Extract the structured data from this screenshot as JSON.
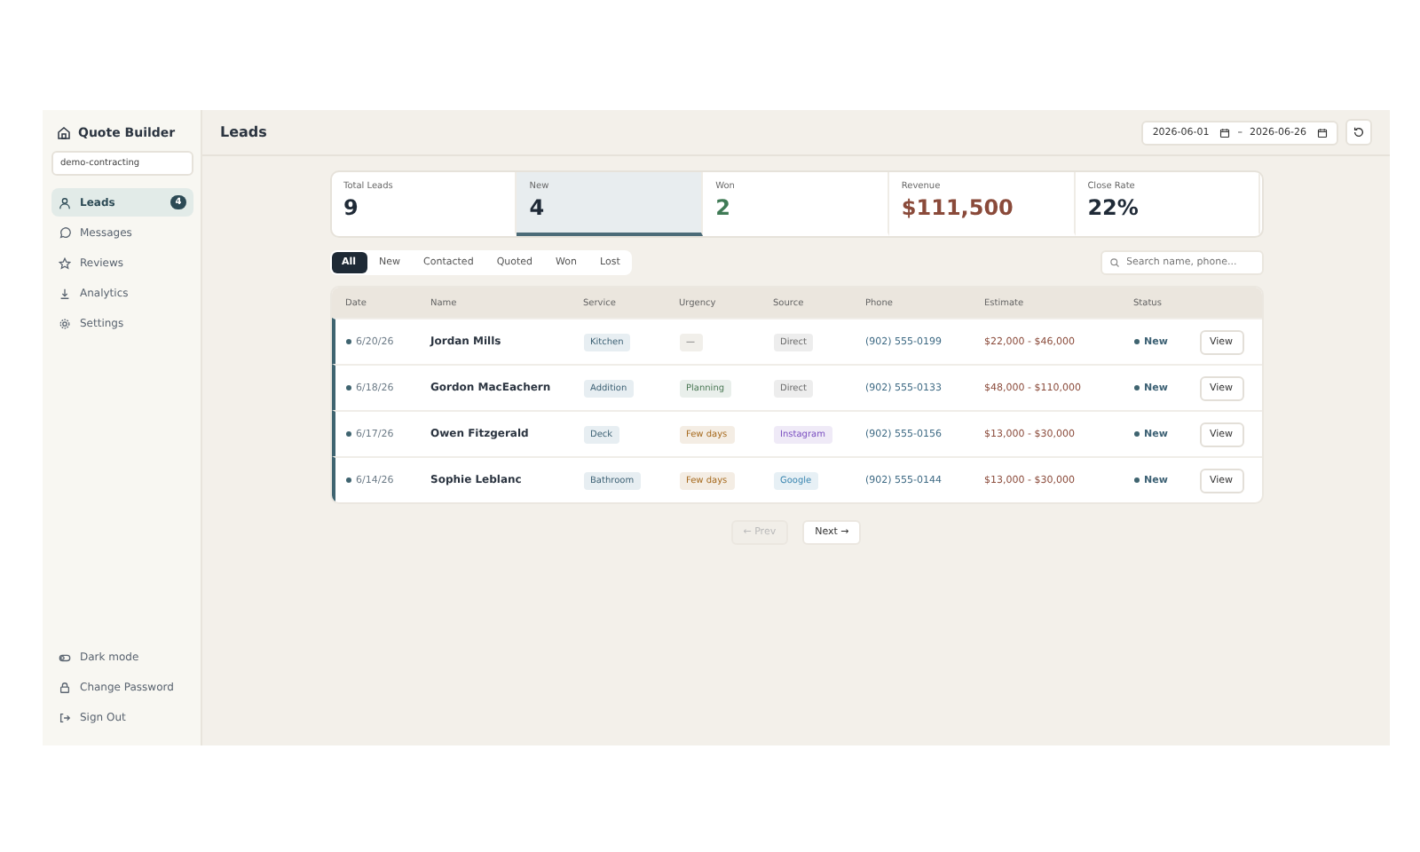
{
  "sidebar": {
    "brand": "Quote Builder",
    "workspace": "demo-contracting",
    "items": [
      {
        "label": "Leads",
        "selected": true,
        "badge": "4"
      },
      {
        "label": "Messages",
        "selected": false
      },
      {
        "label": "Reviews",
        "selected": false
      },
      {
        "label": "Analytics",
        "selected": false
      },
      {
        "label": "Settings",
        "selected": false
      }
    ],
    "footer": [
      {
        "label": "Dark mode"
      },
      {
        "label": "Change Password"
      },
      {
        "label": "Sign Out"
      }
    ]
  },
  "header": {
    "title": "Leads",
    "date_from": "2026-06-01",
    "date_separator": "–",
    "date_to": "2026-06-26"
  },
  "stats": [
    {
      "label": "Total Leads",
      "value": "9",
      "selected": false,
      "color": "#1f2a37"
    },
    {
      "label": "New",
      "value": "4",
      "selected": true,
      "color": "#1f2a37"
    },
    {
      "label": "Won",
      "value": "2",
      "selected": false,
      "color": "#3f7a55"
    },
    {
      "label": "Revenue",
      "value": "$111,500",
      "selected": false,
      "color": "#8a4a3a"
    },
    {
      "label": "Close Rate",
      "value": "22%",
      "selected": false,
      "color": "#1f2a37"
    }
  ],
  "filters": [
    {
      "label": "All",
      "selected": true
    },
    {
      "label": "New",
      "selected": false
    },
    {
      "label": "Contacted",
      "selected": false
    },
    {
      "label": "Quoted",
      "selected": false
    },
    {
      "label": "Won",
      "selected": false
    },
    {
      "label": "Lost",
      "selected": false
    }
  ],
  "search": {
    "placeholder": "Search name, phone..."
  },
  "table": {
    "columns": [
      "Date",
      "Name",
      "Service",
      "Urgency",
      "Source",
      "Phone",
      "Estimate",
      "Status"
    ],
    "rows": [
      {
        "unread": true,
        "date": "6/20/26",
        "name": "Jordan Mills",
        "service": "Kitchen",
        "urgency": {
          "text": "—"
        },
        "source": {
          "text": "Direct",
          "color": "#6b6b6b"
        },
        "phone": "(902) 555-0199",
        "estimate": "$22,000 - $46,000",
        "status": "New",
        "action": "View"
      },
      {
        "unread": true,
        "date": "6/18/26",
        "name": "Gordon MacEachern",
        "service": "Addition",
        "urgency": {
          "text": "Planning",
          "color": "#4d7a57"
        },
        "source": {
          "text": "Direct",
          "color": "#6b6b6b"
        },
        "phone": "(902) 555-0133",
        "estimate": "$48,000 - $110,000",
        "status": "New",
        "action": "View"
      },
      {
        "unread": true,
        "date": "6/17/26",
        "name": "Owen Fitzgerald",
        "service": "Deck",
        "urgency": {
          "text": "Few days",
          "color": "#a66a1e"
        },
        "source": {
          "text": "Instagram",
          "color": "#7a4fc0"
        },
        "phone": "(902) 555-0156",
        "estimate": "$13,000 - $30,000",
        "status": "New",
        "action": "View"
      },
      {
        "unread": true,
        "date": "6/14/26",
        "name": "Sophie Leblanc",
        "service": "Bathroom",
        "urgency": {
          "text": "Few days",
          "color": "#a66a1e"
        },
        "source": {
          "text": "Google",
          "color": "#3b86b0"
        },
        "phone": "(902) 555-0144",
        "estimate": "$13,000 - $30,000",
        "status": "New",
        "action": "View"
      }
    ]
  },
  "pagination": {
    "prev": "← Prev",
    "prev_disabled": true,
    "next": "Next →",
    "next_disabled": false
  }
}
